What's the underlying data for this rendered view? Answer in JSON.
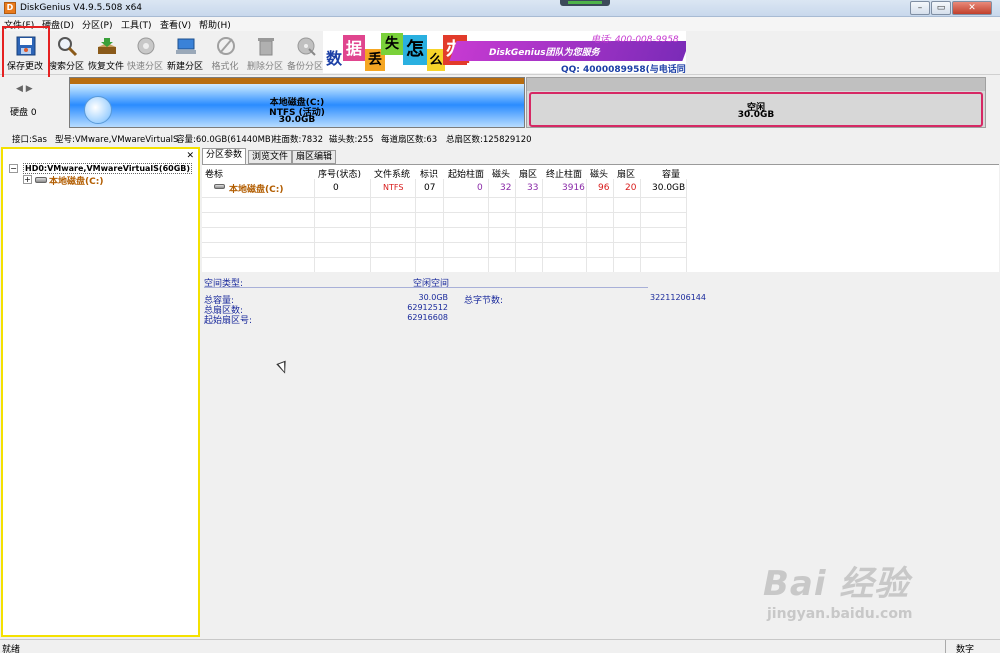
{
  "window": {
    "title": "DiskGenius V4.9.5.508 x64",
    "app_icon": "D",
    "buttons": {
      "minimize": "–",
      "maximize": "▭",
      "close": "✕"
    }
  },
  "menu": [
    "文件(F)",
    "硬盘(D)",
    "分区(P)",
    "工具(T)",
    "查看(V)",
    "帮助(H)"
  ],
  "toolbar": [
    {
      "label": "保存更改",
      "icon": "save-icon",
      "enabled": true
    },
    {
      "label": "搜索分区",
      "icon": "search-icon",
      "enabled": true
    },
    {
      "label": "恢复文件",
      "icon": "recover-icon",
      "enabled": true
    },
    {
      "label": "快速分区",
      "icon": "quick-partition-icon",
      "enabled": false
    },
    {
      "label": "新建分区",
      "icon": "new-partition-icon",
      "enabled": true
    },
    {
      "label": "格式化",
      "icon": "format-icon",
      "enabled": false
    },
    {
      "label": "删除分区",
      "icon": "delete-icon",
      "enabled": false
    },
    {
      "label": "备份分区",
      "icon": "backup-icon",
      "enabled": false
    }
  ],
  "banner": {
    "chars": [
      "数",
      "据",
      "丢",
      "失",
      "怎",
      "么",
      "办",
      "!"
    ],
    "brand": "DiskGenius团队为您服务",
    "tel": "电话: 400-008-9958",
    "qq": "QQ: 4000089958(与电话同号)"
  },
  "diskbar": {
    "nav": "◀ ▶",
    "disk_label": "硬盘 0",
    "partition": {
      "name": "本地磁盘(C:)",
      "fs": "NTFS (活动)",
      "size": "30.0GB"
    },
    "free": {
      "name": "空闲",
      "size": "30.0GB"
    }
  },
  "disk_info": {
    "interface": "接口:Sas",
    "model": "型号:VMware,VMwareVirtualS",
    "capacity": "容量:60.0GB(61440MB)",
    "cylinders": "柱面数:7832",
    "heads": "磁头数:255",
    "sectors_per_track": "每道扇区数:63",
    "total_sectors": "总扇区数:125829120"
  },
  "tree": {
    "root": "HD0:VMware,VMwareVirtualS(60GB)",
    "child": "本地磁盘(C:)",
    "expander_root": "−",
    "expander_child": "+",
    "close": "✕"
  },
  "tabs": [
    "分区参数",
    "浏览文件",
    "扇区编辑"
  ],
  "table": {
    "headers": [
      "卷标",
      "序号(状态)",
      "文件系统",
      "标识",
      "起始柱面",
      "磁头",
      "扇区",
      "终止柱面",
      "磁头",
      "扇区",
      "容量"
    ],
    "rows": [
      [
        "本地磁盘(C:)",
        "0",
        "NTFS",
        "07",
        "0",
        "32",
        "33",
        "3916",
        "96",
        "20",
        "30.0GB"
      ]
    ]
  },
  "details": {
    "space_type_label": "空间类型:",
    "space_type_value": "空闲空间",
    "total_capacity_label": "总容量:",
    "total_capacity_value": "30.0GB",
    "total_bytes_label": "总字节数:",
    "total_bytes_value": "32211206144",
    "total_sectors_label": "总扇区数:",
    "total_sectors_value": "62912512",
    "start_sector_label": "起始扇区号:",
    "start_sector_value": "62916608"
  },
  "status": {
    "left": "就绪",
    "right": "数字"
  },
  "watermark": {
    "main": "Bai 经验",
    "sub": "jingyan.baidu.com"
  },
  "colors": {
    "highlight": "#e52121",
    "free_border": "#d62864",
    "tree_border": "#f4e100",
    "detail_text": "#1a2a9c"
  }
}
